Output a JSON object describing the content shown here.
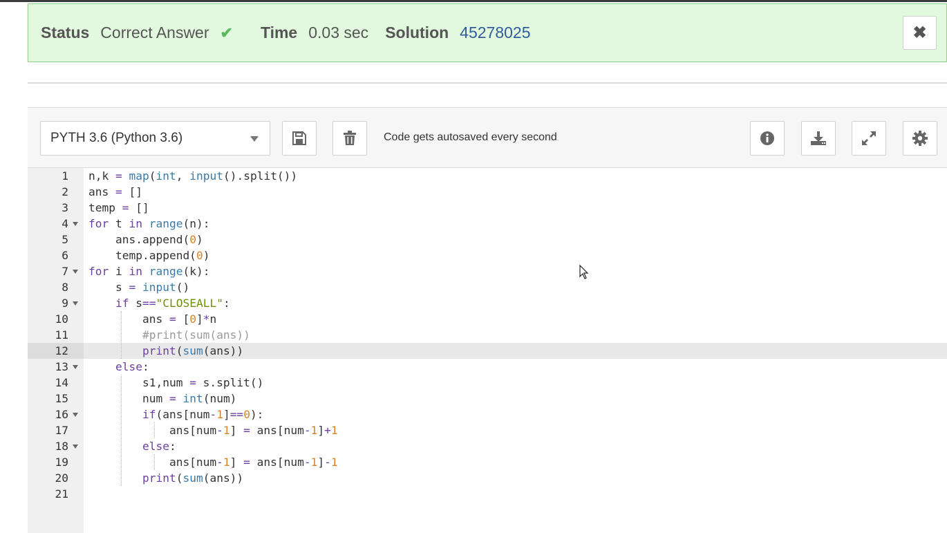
{
  "status": {
    "status_label": "Status",
    "status_value": "Correct Answer",
    "time_label": "Time",
    "time_value": "0.03 sec",
    "solution_label": "Solution",
    "solution_value": "45278025"
  },
  "toolbar": {
    "language": "PYTH 3.6 (Python 3.6)",
    "autosave_text": "Code gets autosaved every second"
  },
  "icons": {
    "check": "check-icon",
    "close": "close-icon",
    "save": "save-icon",
    "delete": "trash-icon",
    "info": "info-icon",
    "download": "download-icon",
    "fullscreen": "expand-icon",
    "settings": "gear-icon"
  },
  "colors": {
    "success_bg": "#e3f9df",
    "success_border": "#8fce8a",
    "link": "#2f5d9b",
    "keyword": "#6c3fa0",
    "builtin": "#3a7aa8",
    "number": "#d9822b",
    "string": "#6e8f0a",
    "comment": "#9a9a9a"
  },
  "editor": {
    "active_line": 12,
    "lines": [
      {
        "n": "1",
        "code": "n,k = map(int, input().split())"
      },
      {
        "n": "2",
        "code": "ans = []"
      },
      {
        "n": "3",
        "code": "temp = []"
      },
      {
        "n": "4",
        "code": "for t in range(n):"
      },
      {
        "n": "5",
        "code": "    ans.append(0)"
      },
      {
        "n": "6",
        "code": "    temp.append(0)"
      },
      {
        "n": "7",
        "code": "for i in range(k):"
      },
      {
        "n": "8",
        "code": "    s = input()"
      },
      {
        "n": "9",
        "code": "    if s==\"CLOSEALL\":"
      },
      {
        "n": "10",
        "code": "        ans = [0]*n"
      },
      {
        "n": "11",
        "code": "        #print(sum(ans))"
      },
      {
        "n": "12",
        "code": "        print(sum(ans))"
      },
      {
        "n": "13",
        "code": "    else:"
      },
      {
        "n": "14",
        "code": "        s1,num = s.split()"
      },
      {
        "n": "15",
        "code": "        num = int(num)"
      },
      {
        "n": "16",
        "code": "        if(ans[num-1]==0):"
      },
      {
        "n": "17",
        "code": "            ans[num-1] = ans[num-1]+1"
      },
      {
        "n": "18",
        "code": "        else:"
      },
      {
        "n": "19",
        "code": "            ans[num-1] = ans[num-1]-1"
      },
      {
        "n": "20",
        "code": "        print(sum(ans))"
      },
      {
        "n": "21",
        "code": ""
      }
    ]
  }
}
